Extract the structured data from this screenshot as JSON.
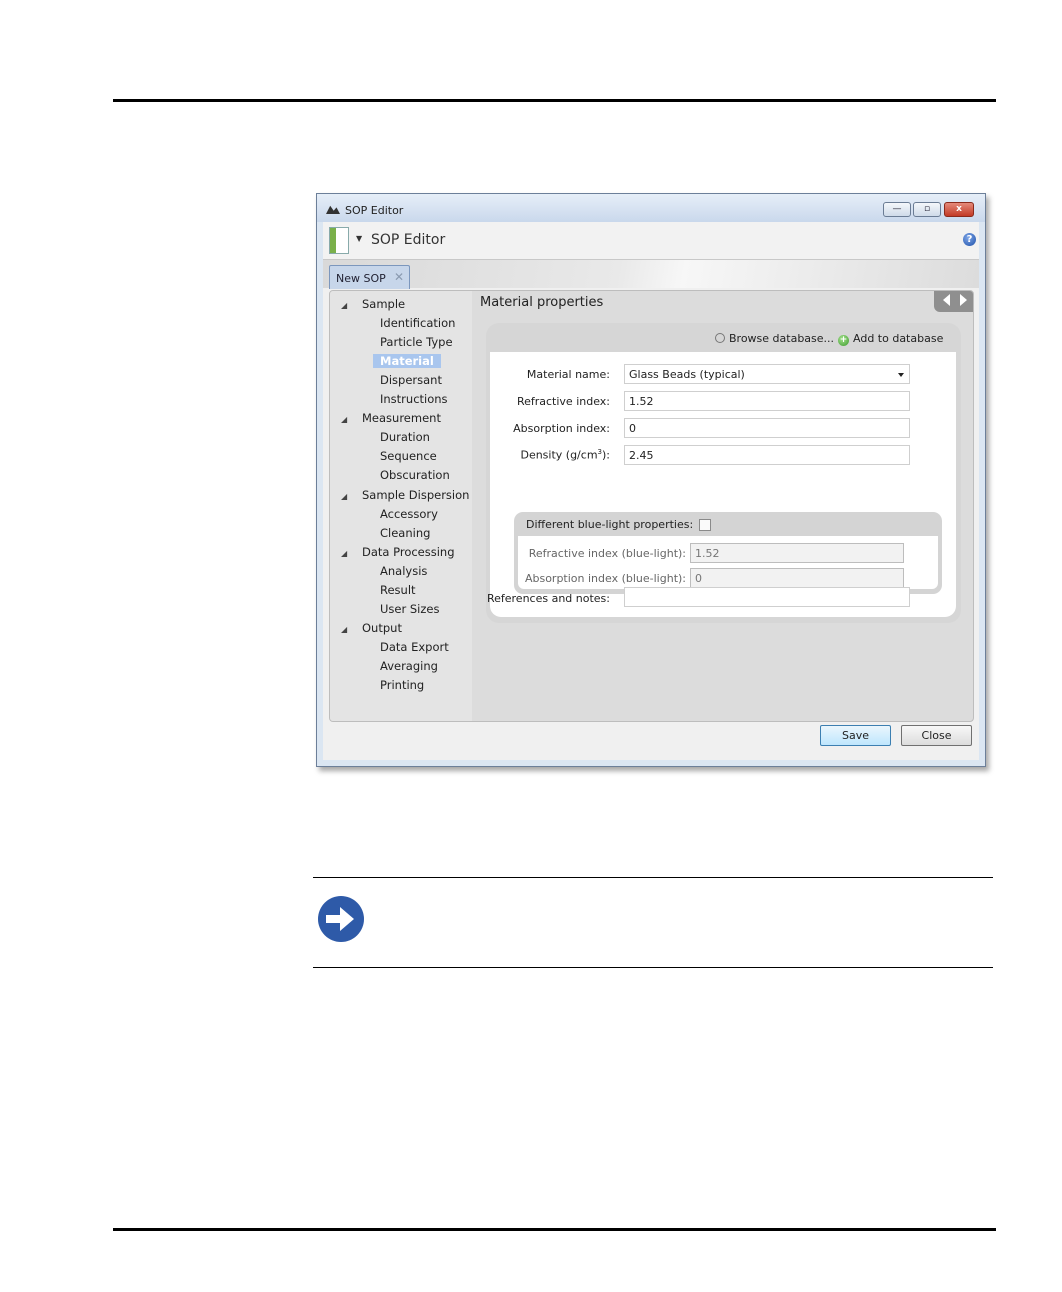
{
  "window": {
    "title": "SOP Editor",
    "min_glyph": "—",
    "max_glyph": "▫",
    "close_glyph": "x"
  },
  "app": {
    "doc_icon": "sop-document-icon",
    "name": "SOP Editor",
    "help_glyph": "?"
  },
  "tab": {
    "label": "New SOP",
    "close_glyph": "✕"
  },
  "nav": [
    {
      "label": "Sample",
      "level": 0,
      "expanded": true
    },
    {
      "label": "Identification",
      "level": 1
    },
    {
      "label": "Particle Type",
      "level": 1
    },
    {
      "label": "Material",
      "level": 1,
      "selected": true
    },
    {
      "label": "Dispersant",
      "level": 1
    },
    {
      "label": "Instructions",
      "level": 1
    },
    {
      "label": "Measurement",
      "level": 0,
      "expanded": true
    },
    {
      "label": "Duration",
      "level": 1
    },
    {
      "label": "Sequence",
      "level": 1
    },
    {
      "label": "Obscuration",
      "level": 1
    },
    {
      "label": "Sample Dispersion",
      "level": 0,
      "expanded": true
    },
    {
      "label": "Accessory",
      "level": 1
    },
    {
      "label": "Cleaning",
      "level": 1
    },
    {
      "label": "Data Processing",
      "level": 0,
      "expanded": true
    },
    {
      "label": "Analysis",
      "level": 1
    },
    {
      "label": "Result",
      "level": 1
    },
    {
      "label": "User Sizes",
      "level": 1
    },
    {
      "label": "Output",
      "level": 0,
      "expanded": true
    },
    {
      "label": "Data Export",
      "level": 1
    },
    {
      "label": "Averaging",
      "level": 1
    },
    {
      "label": "Printing",
      "level": 1
    }
  ],
  "section": {
    "title": "Material properties",
    "browse_label": "Browse database...",
    "add_label": "Add to database"
  },
  "form": {
    "material_name_label": "Material name:",
    "material_name_value": "Glass Beads (typical)",
    "refractive_label": "Refractive index:",
    "refractive_value": "1.52",
    "absorption_label": "Absorption index:",
    "absorption_value": "0",
    "density_label_pre": "Density (g/cm",
    "density_label_sup": "3",
    "density_label_post": "):",
    "density_value": "2.45",
    "blue_title": "Different blue-light properties:",
    "blue_checked": false,
    "blue_refractive_label": "Refractive index (blue-light):",
    "blue_refractive_value": "1.52",
    "blue_absorption_label": "Absorption index (blue-light):",
    "blue_absorption_value": "0",
    "notes_label": "References and notes:",
    "notes_value": ""
  },
  "buttons": {
    "save": "Save",
    "close": "Close"
  },
  "note": {
    "icon": "arrow-right-circle-icon"
  },
  "colors": {
    "selection": "#a9c6ee",
    "note_icon": "#2e5aa8"
  }
}
